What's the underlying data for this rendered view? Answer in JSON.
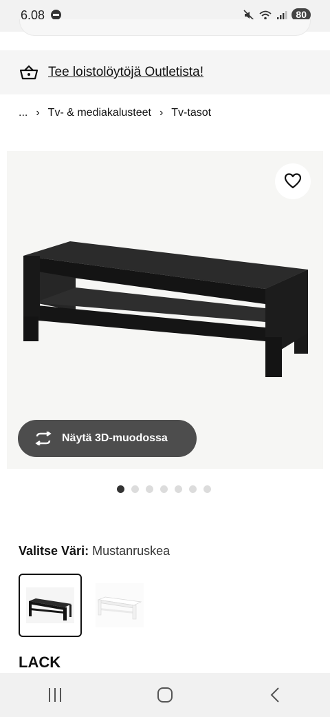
{
  "status_bar": {
    "time": "6.08",
    "battery": "80"
  },
  "banner": {
    "text": "Tee loistolöytöjä Outletista!",
    "icon": "basket-icon"
  },
  "breadcrumb": {
    "items": [
      "...",
      "Tv- & mediakalusteet",
      "Tv-tasot"
    ],
    "separator_icon": "chevron-right-icon"
  },
  "gallery": {
    "favourite_icon": "heart-icon",
    "view_3d_label": "Näytä 3D-muodossa",
    "view_3d_icon": "rotate-3d-icon",
    "image_count": 7,
    "active_index": 0
  },
  "colour": {
    "label": "Valitse Väri:",
    "value": "Mustanruskea",
    "options": [
      "Mustanruskea",
      "Valkoinen"
    ]
  },
  "product": {
    "name": "LACK"
  },
  "nav_bar": {
    "icons": [
      "recent-apps-icon",
      "home-icon",
      "back-icon"
    ]
  },
  "colors": {
    "image_bg": "#f5f5f5",
    "button_dark": "#4d4d4d",
    "furniture_dark": "#1e1e1e"
  }
}
